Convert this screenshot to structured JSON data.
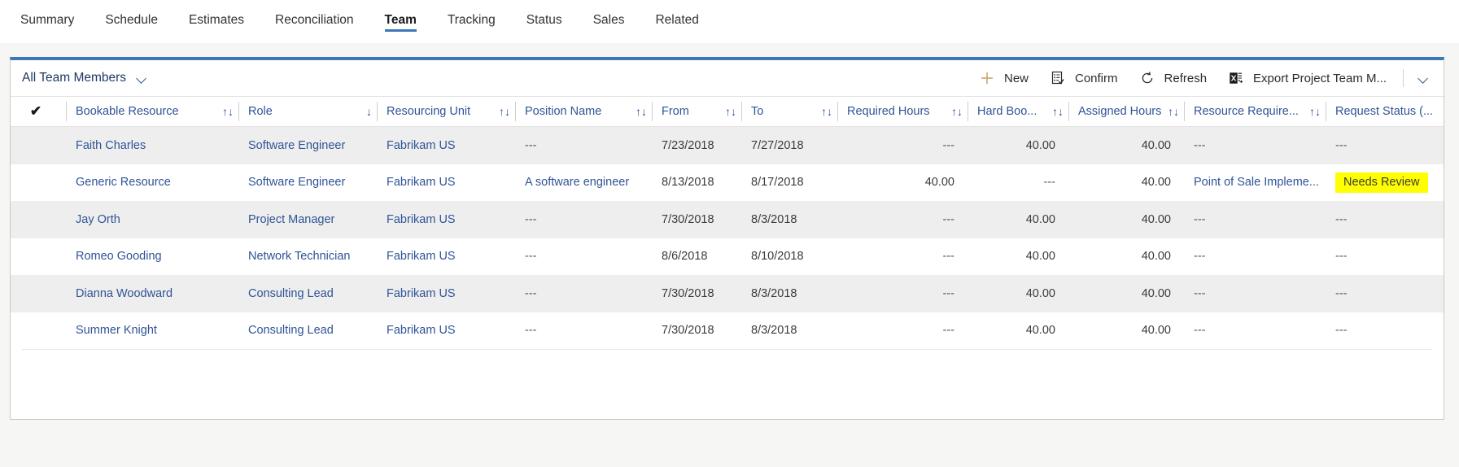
{
  "tabs": [
    {
      "label": "Summary",
      "active": false
    },
    {
      "label": "Schedule",
      "active": false
    },
    {
      "label": "Estimates",
      "active": false
    },
    {
      "label": "Reconciliation",
      "active": false
    },
    {
      "label": "Team",
      "active": true
    },
    {
      "label": "Tracking",
      "active": false
    },
    {
      "label": "Status",
      "active": false
    },
    {
      "label": "Sales",
      "active": false
    },
    {
      "label": "Related",
      "active": false
    }
  ],
  "commandbar": {
    "view_selector_label": "All Team Members",
    "view_selector_icon": "chevron-down-icon",
    "actions": [
      {
        "label": "New",
        "icon": "plus-icon"
      },
      {
        "label": "Confirm",
        "icon": "confirm-list-icon"
      },
      {
        "label": "Refresh",
        "icon": "refresh-icon"
      },
      {
        "label": "Export Project Team M...",
        "icon": "excel-export-icon"
      }
    ],
    "overflow_icon": "chevron-down-icon"
  },
  "grid": {
    "select_all_icon": "checkmark-icon",
    "columns": [
      {
        "label": "Bookable Resource",
        "sort": "both"
      },
      {
        "label": "Role",
        "sort": "desc"
      },
      {
        "label": "Resourcing Unit",
        "sort": "both"
      },
      {
        "label": "Position Name",
        "sort": "both"
      },
      {
        "label": "From",
        "sort": "both"
      },
      {
        "label": "To",
        "sort": "both"
      },
      {
        "label": "Required Hours",
        "sort": "both"
      },
      {
        "label": "Hard Boo...",
        "sort": "both"
      },
      {
        "label": "Assigned Hours",
        "sort": "both"
      },
      {
        "label": "Resource Require...",
        "sort": "both"
      },
      {
        "label": "Request Status (...",
        "sort": "none"
      }
    ],
    "rows": [
      {
        "bookable_resource": "Faith Charles",
        "role": "Software Engineer",
        "resourcing_unit": "Fabrikam US",
        "position_name": "---",
        "from": "7/23/2018",
        "to": "7/27/2018",
        "required_hours": "---",
        "hard_booked_hours": "40.00",
        "assigned_hours": "40.00",
        "resource_requirement": "---",
        "request_status": "---",
        "request_status_highlighted": false
      },
      {
        "bookable_resource": "Generic Resource",
        "role": "Software Engineer",
        "resourcing_unit": "Fabrikam US",
        "position_name": "A software engineer",
        "from": "8/13/2018",
        "to": "8/17/2018",
        "required_hours": "40.00",
        "hard_booked_hours": "---",
        "assigned_hours": "40.00",
        "resource_requirement": "Point of Sale Impleme...",
        "request_status": "Needs Review",
        "request_status_highlighted": true
      },
      {
        "bookable_resource": "Jay Orth",
        "role": "Project Manager",
        "resourcing_unit": "Fabrikam US",
        "position_name": "---",
        "from": "7/30/2018",
        "to": "8/3/2018",
        "required_hours": "---",
        "hard_booked_hours": "40.00",
        "assigned_hours": "40.00",
        "resource_requirement": "---",
        "request_status": "---",
        "request_status_highlighted": false
      },
      {
        "bookable_resource": "Romeo Gooding",
        "role": "Network Technician",
        "resourcing_unit": "Fabrikam US",
        "position_name": "---",
        "from": "8/6/2018",
        "to": "8/10/2018",
        "required_hours": "---",
        "hard_booked_hours": "40.00",
        "assigned_hours": "40.00",
        "resource_requirement": "---",
        "request_status": "---",
        "request_status_highlighted": false
      },
      {
        "bookable_resource": "Dianna Woodward",
        "role": "Consulting Lead",
        "resourcing_unit": "Fabrikam US",
        "position_name": "---",
        "from": "7/30/2018",
        "to": "8/3/2018",
        "required_hours": "---",
        "hard_booked_hours": "40.00",
        "assigned_hours": "40.00",
        "resource_requirement": "---",
        "request_status": "---",
        "request_status_highlighted": false
      },
      {
        "bookable_resource": "Summer Knight",
        "role": "Consulting Lead",
        "resourcing_unit": "Fabrikam US",
        "position_name": "---",
        "from": "7/30/2018",
        "to": "8/3/2018",
        "required_hours": "---",
        "hard_booked_hours": "40.00",
        "assigned_hours": "40.00",
        "resource_requirement": "---",
        "request_status": "---",
        "request_status_highlighted": false
      }
    ]
  },
  "colors": {
    "accent_blue": "#3b78b8",
    "link_blue": "#2f5496",
    "highlight_yellow": "#ffff00",
    "page_background": "#f6f6f4",
    "row_alt": "#eeeeee"
  }
}
